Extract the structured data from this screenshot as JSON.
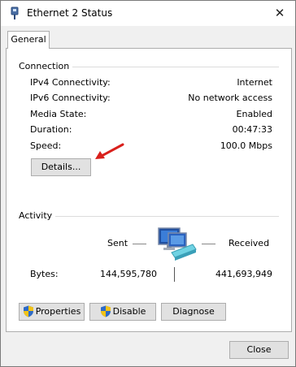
{
  "window": {
    "title": "Ethernet 2 Status",
    "close_glyph": "✕"
  },
  "tabs": [
    {
      "label": "General"
    }
  ],
  "connection": {
    "heading": "Connection",
    "rows": [
      {
        "label": "IPv4 Connectivity:",
        "value": "Internet"
      },
      {
        "label": "IPv6 Connectivity:",
        "value": "No network access"
      },
      {
        "label": "Media State:",
        "value": "Enabled"
      },
      {
        "label": "Duration:",
        "value": "00:47:33"
      },
      {
        "label": "Speed:",
        "value": "100.0 Mbps"
      }
    ],
    "details_label": "Details..."
  },
  "activity": {
    "heading": "Activity",
    "sent_label": "Sent",
    "received_label": "Received",
    "bytes_label": "Bytes:",
    "bytes_sent": "144,595,780",
    "bytes_received": "441,693,949"
  },
  "actions": {
    "properties_label": "Properties",
    "disable_label": "Disable",
    "diagnose_label": "Diagnose",
    "close_label": "Close"
  },
  "icons": {
    "title": "network-adapter-icon",
    "network": "network-computers-icon",
    "shield": "uac-shield-icon",
    "annotation": "red-arrow-annotation"
  },
  "colors": {
    "annotation_arrow": "#d9201c",
    "button_bg": "#e1e1e1",
    "panel_bg": "#ffffff",
    "window_bg": "#f0f0f0"
  }
}
